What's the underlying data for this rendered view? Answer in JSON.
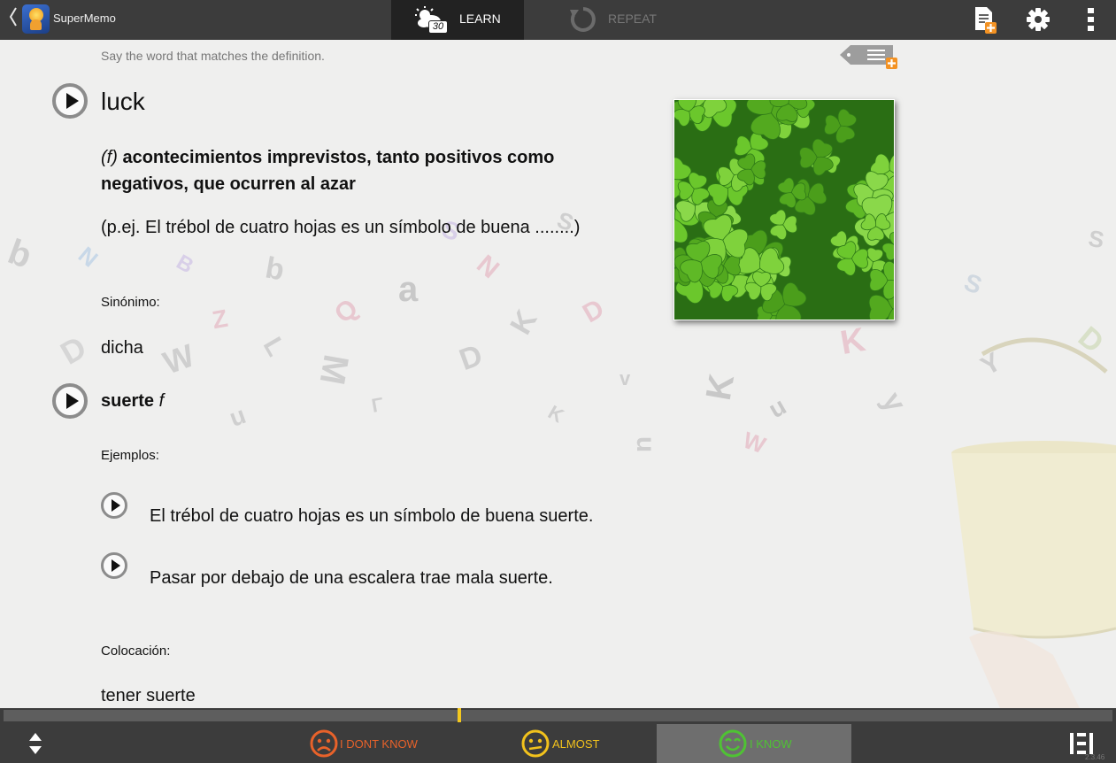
{
  "app": {
    "name": "SuperMemo",
    "back_icon": "chevron-left-icon",
    "version": "2.3.46"
  },
  "tabs": {
    "learn": {
      "label": "LEARN",
      "count": "30",
      "active": true
    },
    "repeat": {
      "label": "REPEAT",
      "active": false
    }
  },
  "toolbar": {
    "add_note_icon": "document-add-icon",
    "settings_icon": "gear-icon",
    "more_icon": "vertical-dots-icon"
  },
  "card": {
    "instruction": "Say the word that matches the definition.",
    "word": "luck",
    "definition_gram": "(f)",
    "definition": "acontecimientos imprevistos, tanto positivos como negativos, que ocurren al azar",
    "definition_example": "(p.ej. El trébol de cuatro hojas es un símbolo de buena ........)",
    "synonym_label": "Sinónimo:",
    "synonym_1": "dicha",
    "synonym_2": "suerte",
    "synonym_2_gram": "f",
    "examples_label": "Ejemplos:",
    "examples": [
      "El trébol de cuatro hojas es un símbolo de buena suerte.",
      "Pasar por debajo de una escalera trae mala suerte."
    ],
    "collocation_label": "Colocación:",
    "collocation": "tener suerte"
  },
  "progress": {
    "fraction": 0.41
  },
  "grades": {
    "dont_know": "I DONT KNOW",
    "almost": "ALMOST",
    "know": "I KNOW"
  },
  "colors": {
    "topbar": "#3c3c3c",
    "active_tab": "#222222",
    "dont_know": "#e8622a",
    "almost": "#f2c21c",
    "know": "#4fc234",
    "progress_marker": "#f4c81e"
  }
}
